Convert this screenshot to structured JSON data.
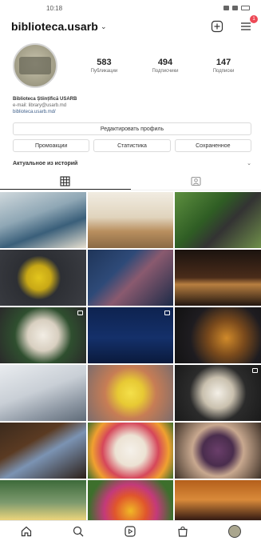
{
  "status_bar": {
    "time": "10:18"
  },
  "header": {
    "username": "biblioteca.usarb",
    "notification_count": "1"
  },
  "profile": {
    "stats": [
      {
        "number": "583",
        "label": "Публикации"
      },
      {
        "number": "494",
        "label": "Подписчики"
      },
      {
        "number": "147",
        "label": "Подписки"
      }
    ],
    "bio": {
      "name": "Biblioteca Științifică USARB",
      "line2": "e-mail: library@usarb.md",
      "link": "biblioteca.usarb.md/"
    }
  },
  "actions": {
    "edit_profile": "Редактировать профиль",
    "promotions": "Промоакции",
    "insights": "Статистика",
    "saved": "Сохраненное"
  },
  "highlights": {
    "label": "Актуальное из историй"
  },
  "tabs": [
    {
      "icon": "grid-icon",
      "active": true
    },
    {
      "icon": "tagged-icon",
      "active": false
    }
  ],
  "grid": {
    "posts": [
      {
        "bg": "linear-gradient(160deg,#cfd8dc 0%,#8fa7b5 40%,#3a5f7a 65%,#e7e0d0 100%)",
        "multi": false
      },
      {
        "bg": "linear-gradient(180deg,#f1ece2 0%,#e0d4bd 45%,#b98f5f 70%,#8a6a45 100%)",
        "multi": false
      },
      {
        "bg": "linear-gradient(135deg,#5d8f3f 0%,#2f5d24 40%,#333 60%,#6f8f4a 100%)",
        "multi": false
      },
      {
        "bg": "radial-gradient(circle at 45% 50%,#e3c61d 0%,#c8a816 22%,#2d2f34 40%,#3b3d43 100%)",
        "multi": false
      },
      {
        "bg": "linear-gradient(135deg,#1f3559 0%,#2e4a78 35%,#8a5a6f 55%,#1c2b48 100%)",
        "multi": false
      },
      {
        "bg": "linear-gradient(180deg,#1b130f 0%,#4a2c1a 50%,#b87f40 62%,#231610 100%)",
        "multi": false
      },
      {
        "bg": "radial-gradient(circle at 50% 50%,#f2ede4 0%,#d8cfc0 30%,#2f4f2f 55%,#2a2a2a 100%)",
        "multi": true
      },
      {
        "bg": "linear-gradient(180deg,#0e2350 0%,#14306a 55%,#0a1a3c 100%)",
        "multi": true
      },
      {
        "bg": "radial-gradient(circle at 60% 55%,#d08a2a 0%,#7a4a1c 30%,#1e1c20 60%,#111 100%)",
        "multi": false
      },
      {
        "bg": "linear-gradient(160deg,#e9ecef 0%,#c9cfd6 45%,#8d97a3 75%,#5f6b78 100%)",
        "multi": false
      },
      {
        "bg": "radial-gradient(circle at 50% 50%,#f4e04a 0%,#e7c934 25%,#c77d55 50%,#7c6c6c 100%)",
        "multi": false
      },
      {
        "bg": "radial-gradient(circle at 50% 50%,#f3efe6 0%,#c9c0ae 30%,#2b2b2b 55%,#1a1a1a 100%)",
        "multi": true
      },
      {
        "bg": "linear-gradient(150deg,#3b2a1d 0%,#5a3a22 35%,#7b93b3 55%,#2c1f18 100%)",
        "multi": false
      },
      {
        "bg": "radial-gradient(circle at 50% 50%,#f5f1ea 0%,#ece2d3 30%,#d6475a 55%,#f0a030 75%,#3d6d2e 100%)",
        "multi": false
      },
      {
        "bg": "radial-gradient(circle at 50% 50%,#6a3e6a 0%,#4a2d4d 30%,#c8a88f 50%,#3f3228 100%)",
        "multi": false
      },
      {
        "bg": "linear-gradient(180deg,#3d6a3a 0%,#7d9a6e 40%,#e7d37b 70%,#c43c2e 100%)",
        "multi": false
      },
      {
        "bg": "radial-gradient(circle at 50% 55%,#f0b826 0%,#e0562c 30%,#c43a7a 50%,#3d6f2c 80%)",
        "multi": false
      },
      {
        "bg": "linear-gradient(180deg,#b45f1b 0%,#d98a3a 35%,#3a1f14 70%,#1c100a 100%)",
        "multi": false
      }
    ]
  }
}
